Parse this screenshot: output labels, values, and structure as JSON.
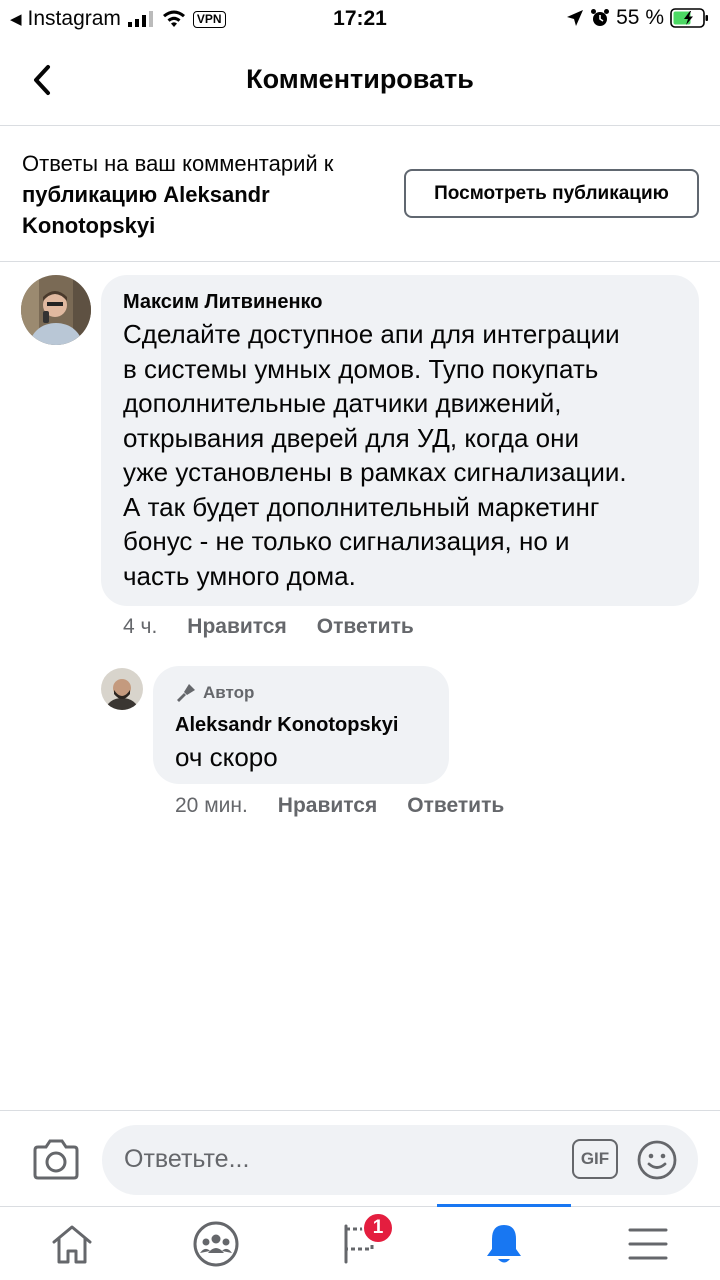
{
  "status_bar": {
    "back_app": "Instagram",
    "vpn": "VPN",
    "time": "17:21",
    "battery": "55 %"
  },
  "header": {
    "title": "Комментировать"
  },
  "info": {
    "text_normal": "Ответы на ваш комментарий к",
    "text_bold": "публикацию Aleksandr Konotopskyi",
    "button": "Посмотреть публикацию"
  },
  "comments": [
    {
      "author": "Максим Литвиненко",
      "lines": [
        "Сделайте доступное апи для интеграции",
        "в системы умных домов.  Тупо покупать",
        "дополнительные датчики движений,",
        "открывания дверей для УД, когда они",
        "уже установлены в рамках сигнализации.",
        "А так будет дополнительный маркетинг",
        "бонус - не только сигнализация, но и",
        "часть умного дома."
      ],
      "time": "4 ч.",
      "like": "Нравится",
      "reply": "Ответить"
    },
    {
      "badge": "Автор",
      "author": "Aleksandr Konotopskyi",
      "text": "оч скоро",
      "time": "20 мин.",
      "like": "Нравится",
      "reply": "Ответить"
    }
  ],
  "input": {
    "placeholder": "Ответьте...",
    "gif": "GIF"
  },
  "tabs": {
    "notifications_badge": "1"
  },
  "colors": {
    "accent": "#1877f2",
    "bubble": "#f0f2f5",
    "secondary_text": "#65676b",
    "badge": "#e41e3f",
    "battery": "#4cd964"
  }
}
